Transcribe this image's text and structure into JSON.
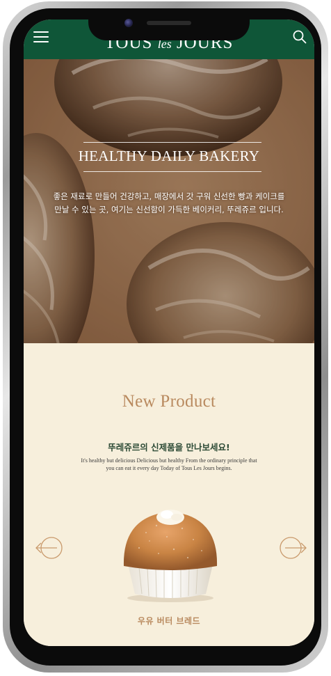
{
  "header": {
    "logo_main": "TOUS ",
    "logo_les": "les",
    "logo_end": " JOURS",
    "menu_icon": "hamburger-menu-icon",
    "search_icon": "search-icon",
    "background_color": "#0f5638"
  },
  "hero": {
    "title": "HEALTHY DAILY BAKERY",
    "description": "좋은 재료로 만들어 건강하고, 매장에서 갓 구워 신선한 빵과 케이크를 만날 수 있는 곳, 여기는 신선함이 가득한 베이커리, 뚜레쥬르 입니다."
  },
  "new_product": {
    "title": "New Product",
    "subtitle": "뚜레쥬르의 신제품을 만나보세요!",
    "description": "It's healthy but delicious Delicious but healthy From the ordinary principle that you can eat it every day Today of Tous Les Jours begins.",
    "prev_icon": "arrow-left-icon",
    "next_icon": "arrow-right-icon",
    "product_name": "우유 버터 브레드",
    "accent_color": "#b98a5f",
    "background_color": "#f7efdc"
  }
}
